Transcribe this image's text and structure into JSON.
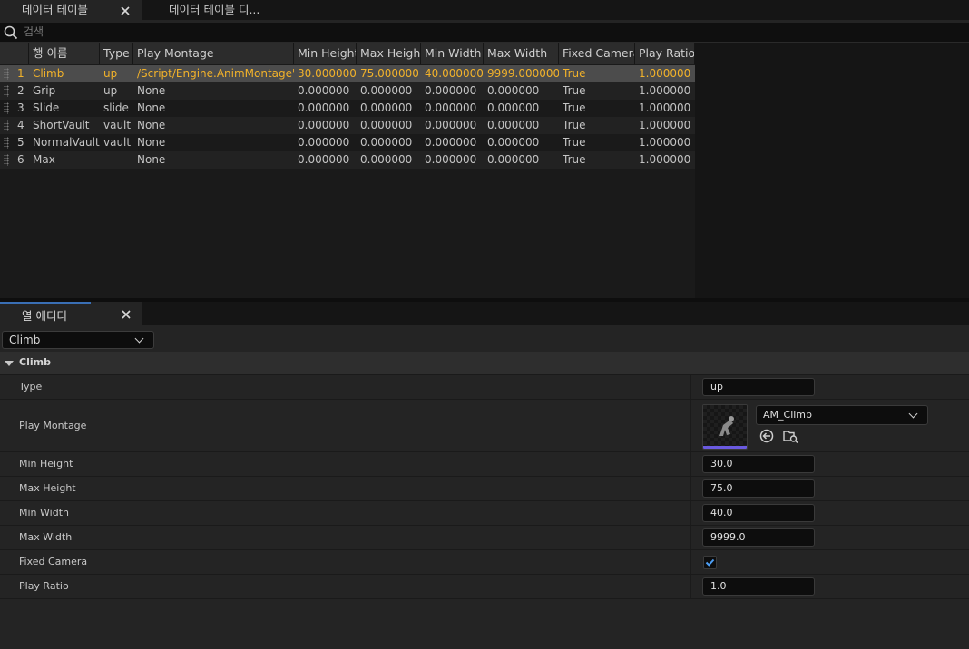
{
  "tabs": [
    {
      "label": "데이터 테이블"
    },
    {
      "label": "데이터 테이블 디..."
    }
  ],
  "search": {
    "placeholder": "검색",
    "value": ""
  },
  "table": {
    "columns": [
      "행 이름",
      "Type",
      "Play Montage",
      "Min Height",
      "Max Height",
      "Min Width",
      "Max Width",
      "Fixed Camera",
      "Play Ratio"
    ],
    "rows": [
      {
        "index": "1",
        "name": "Climb",
        "type": "up",
        "montage": "/Script/Engine.AnimMontage'/Game",
        "min_height": "30.000000",
        "max_height": "75.000000",
        "min_width": "40.000000",
        "max_width": "9999.000000",
        "fixed_camera": "True",
        "play_ratio": "1.000000"
      },
      {
        "index": "2",
        "name": "Grip",
        "type": "up",
        "montage": "None",
        "min_height": "0.000000",
        "max_height": "0.000000",
        "min_width": "0.000000",
        "max_width": "0.000000",
        "fixed_camera": "True",
        "play_ratio": "1.000000"
      },
      {
        "index": "3",
        "name": "Slide",
        "type": "slide",
        "montage": "None",
        "min_height": "0.000000",
        "max_height": "0.000000",
        "min_width": "0.000000",
        "max_width": "0.000000",
        "fixed_camera": "True",
        "play_ratio": "1.000000"
      },
      {
        "index": "4",
        "name": "ShortVault",
        "type": "vault",
        "montage": "None",
        "min_height": "0.000000",
        "max_height": "0.000000",
        "min_width": "0.000000",
        "max_width": "0.000000",
        "fixed_camera": "True",
        "play_ratio": "1.000000"
      },
      {
        "index": "5",
        "name": "NormalVault",
        "type": "vault",
        "montage": "None",
        "min_height": "0.000000",
        "max_height": "0.000000",
        "min_width": "0.000000",
        "max_width": "0.000000",
        "fixed_camera": "True",
        "play_ratio": "1.000000"
      },
      {
        "index": "6",
        "name": "Max",
        "type": "",
        "montage": "None",
        "min_height": "0.000000",
        "max_height": "0.000000",
        "min_width": "0.000000",
        "max_width": "0.000000",
        "fixed_camera": "True",
        "play_ratio": "1.000000"
      }
    ]
  },
  "row_editor": {
    "tab_label": "열 에디터",
    "selected_row": "Climb",
    "category": "Climb",
    "labels": {
      "type": "Type",
      "play_montage": "Play Montage",
      "min_height": "Min Height",
      "max_height": "Max Height",
      "min_width": "Min Width",
      "max_width": "Max Width",
      "fixed_camera": "Fixed Camera",
      "play_ratio": "Play Ratio"
    },
    "values": {
      "type": "up",
      "play_montage": "AM_Climb",
      "min_height": "30.0",
      "max_height": "75.0",
      "min_width": "40.0",
      "max_width": "9999.0",
      "fixed_camera": true,
      "play_ratio": "1.0"
    }
  },
  "colors": {
    "selected_text": "#f2b22a",
    "accent": "#3a6fb5",
    "checkbox_check": "#4d9ff5"
  },
  "icons": [
    "close-icon",
    "search-icon",
    "grip-handle-icon",
    "chevron-down-icon",
    "collapse-triangle-icon",
    "use-selected-asset-icon",
    "browse-asset-icon",
    "checkmark-icon"
  ]
}
